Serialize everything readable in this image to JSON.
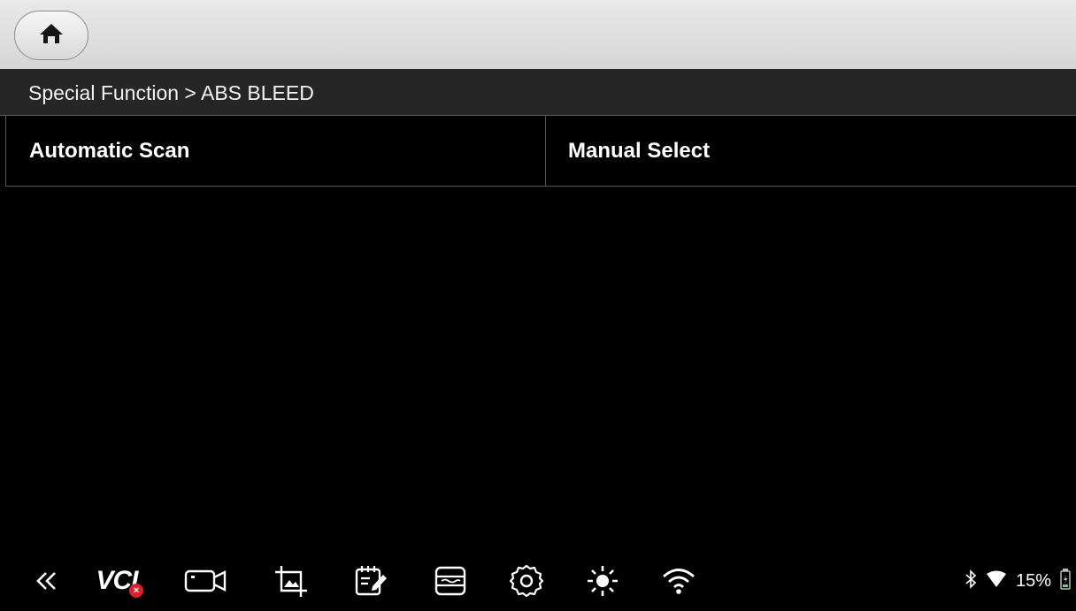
{
  "topbar": {
    "home_icon": "home-icon"
  },
  "breadcrumb": {
    "text": "Special Function > ABS BLEED"
  },
  "options": [
    {
      "label": "Automatic Scan"
    },
    {
      "label": "Manual Select"
    }
  ],
  "taskbar": {
    "icons": [
      "back-double-chevron-icon",
      "vci-icon",
      "video-camera-icon",
      "screenshot-icon",
      "notepad-icon",
      "printer-icon",
      "settings-icon",
      "brightness-icon",
      "wifi-icon"
    ],
    "vci_label": "VCI",
    "vci_status": "×"
  },
  "status": {
    "battery_percent": "15%",
    "icons": [
      "bluetooth-icon",
      "wifi-signal-icon",
      "battery-icon"
    ]
  }
}
